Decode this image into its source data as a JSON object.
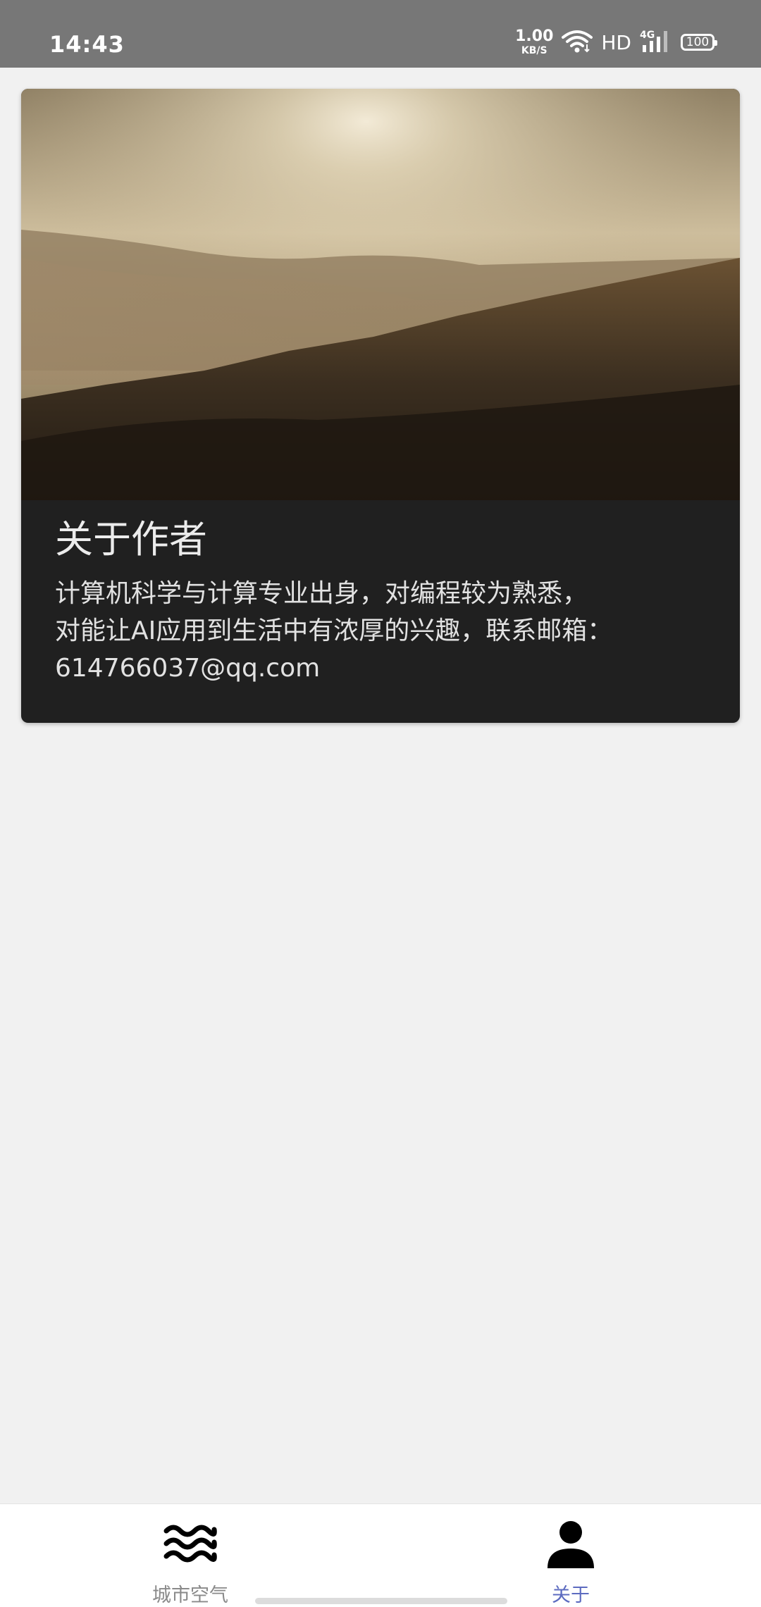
{
  "status_bar": {
    "time": "14:43",
    "net_speed_value": "1.00",
    "net_speed_unit": "KB/S",
    "wifi_icon": "wifi-icon",
    "hd": "HD",
    "network": "4G",
    "signal_icon": "signal-bars-icon",
    "battery": "100"
  },
  "card": {
    "image_icon": "forest-sunrise-photo",
    "title": "关于作者",
    "description_lines": [
      "计算机科学与计算专业出身，对编程较为熟悉，",
      "对能让AI应用到生活中有浓厚的兴趣，联系邮箱：",
      "614766037@qq.com"
    ]
  },
  "bottom_nav": {
    "items": [
      {
        "label": "城市空气",
        "icon": "waves-icon",
        "active": false
      },
      {
        "label": "关于",
        "icon": "person-icon",
        "active": true
      }
    ]
  },
  "colors": {
    "status_bar_bg": "#777777",
    "page_bg": "#f1f1f1",
    "card_body_bg": "#202020",
    "nav_active": "#5c6bc0",
    "nav_inactive": "#8a8a8a"
  }
}
